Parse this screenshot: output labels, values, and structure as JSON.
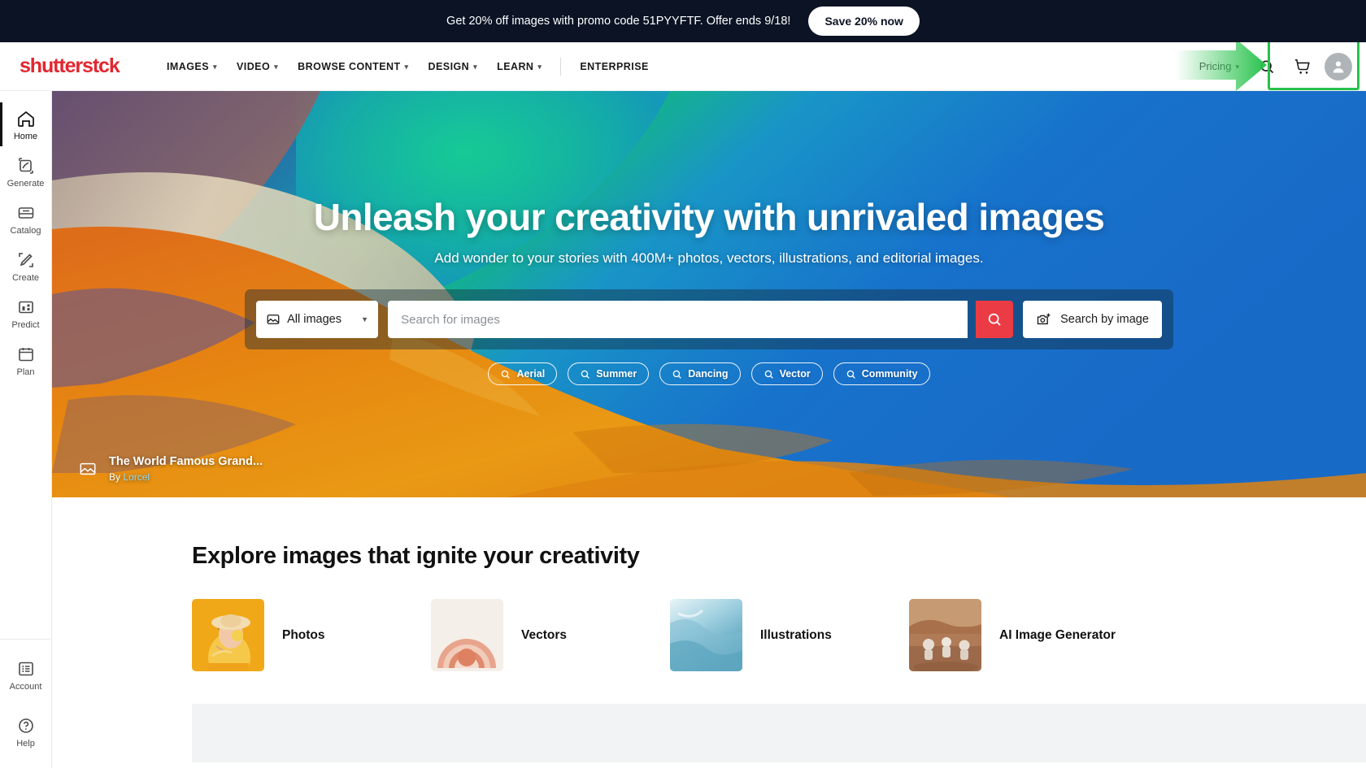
{
  "promo": {
    "text": "Get 20% off images with promo code 51PYYFTF. Offer ends 9/18!",
    "button": "Save 20% now",
    "bg_color": "#0b1324"
  },
  "header": {
    "logo": "shutterstck",
    "nav": [
      {
        "label": "IMAGES",
        "has_caret": true
      },
      {
        "label": "VIDEO",
        "has_caret": true
      },
      {
        "label": "BROWSE CONTENT",
        "has_caret": true
      },
      {
        "label": "DESIGN",
        "has_caret": true
      },
      {
        "label": "LEARN",
        "has_caret": true
      },
      {
        "label": "ENTERPRISE",
        "has_caret": false
      }
    ],
    "pricing": "Pricing",
    "icons": {
      "search": "search-icon",
      "cart": "cart-icon",
      "account": "account-avatar-icon"
    },
    "annotation": {
      "highlight_color": "#27c24c",
      "arrow": "green-right-arrow",
      "target": "cart-and-account-icons"
    }
  },
  "sidebar": {
    "items": [
      {
        "label": "Home",
        "icon": "home-icon",
        "active": true
      },
      {
        "label": "Generate",
        "icon": "generate-icon",
        "active": false
      },
      {
        "label": "Catalog",
        "icon": "catalog-icon",
        "active": false
      },
      {
        "label": "Create",
        "icon": "create-pencil-icon",
        "active": false
      },
      {
        "label": "Predict",
        "icon": "predict-grid-icon",
        "active": false
      },
      {
        "label": "Plan",
        "icon": "plan-calendar-icon",
        "active": false
      }
    ],
    "bottom_items": [
      {
        "label": "Account",
        "icon": "account-list-icon"
      },
      {
        "label": "Help",
        "icon": "help-question-icon"
      }
    ]
  },
  "hero": {
    "title": "Unleash your creativity with unrivaled images",
    "subtitle": "Add wonder to your stories with 400M+ photos, vectors, illustrations, and editorial images.",
    "search": {
      "type_selector": "All images",
      "placeholder": "Search for images",
      "value": "",
      "submit_icon": "search-icon",
      "submit_color": "#eb3b44",
      "search_by_image": "Search by image"
    },
    "chips": [
      {
        "label": "Aerial",
        "icon": "search-icon"
      },
      {
        "label": "Summer",
        "icon": "search-icon"
      },
      {
        "label": "Dancing",
        "icon": "search-icon"
      },
      {
        "label": "Vector",
        "icon": "search-icon"
      },
      {
        "label": "Community",
        "icon": "search-icon"
      }
    ],
    "attribution": {
      "icon": "image-icon",
      "title": "The World Famous Grand...",
      "by_label": "By",
      "author": "Lorcel"
    }
  },
  "explore": {
    "title": "Explore images that ignite your creativity",
    "categories": [
      {
        "label": "Photos",
        "thumb": "woman-in-yellow-with-hat"
      },
      {
        "label": "Vectors",
        "thumb": "concentric-arches-pattern"
      },
      {
        "label": "Illustrations",
        "thumb": "blue-watercolor-texture"
      },
      {
        "label": "AI Image Generator",
        "thumb": "astronauts-on-mars"
      }
    ]
  }
}
